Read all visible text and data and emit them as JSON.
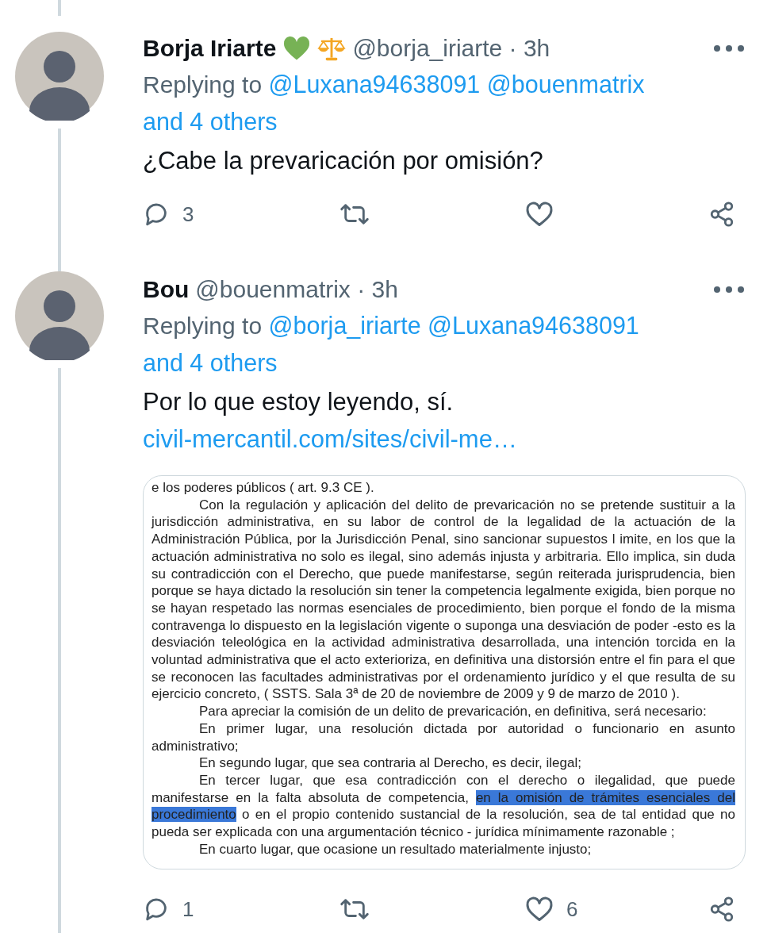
{
  "tweets": [
    {
      "author": "Borja Iriarte",
      "badges": [
        {
          "kind": "heart"
        },
        {
          "kind": "scales"
        }
      ],
      "meta": "@borja_iriarte · 3h",
      "replying_label": "Replying to",
      "mentions": [
        "@Luxana94638091",
        "@bouenmatrix"
      ],
      "others": "and 4 others",
      "text": "¿Cabe la prevaricación por omisión?",
      "stats": {
        "replies": "3"
      }
    },
    {
      "author": "Bou",
      "meta": "@bouenmatrix · 3h",
      "replying_label": "Replying to",
      "mentions": [
        "@borja_iriarte",
        "@Luxana94638091"
      ],
      "others": "and 4 others",
      "text": "Por lo que estoy leyendo, sí.",
      "link": "civil-mercantil.com/sites/civil-me…",
      "document": [
        {
          "indent": false,
          "text": "e los poderes públicos ( art. 9.3 CE )."
        },
        {
          "indent": true,
          "text": "Con la regulación y aplicación del delito de prevaricación no se pretende sustituir a la jurisdicción administrativa, en su labor de control de la legalidad de la actuación de la Administración Pública, por la Jurisdicción Penal, sino sancionar supuestos l imite, en los que la actuación administrativa no solo es ilegal, sino además injusta y arbitraria. Ello implica, sin duda su contradicción con el Derecho, que puede manifestarse, según reiterada jurisprudencia, bien porque se haya dictado la resolución sin tener la competencia legalmente exigida, bien porque no se hayan respetado las normas esenciales de procedimiento, bien porque el fondo de la misma contravenga lo dispuesto en la legislación vigente o suponga una desviación de poder -esto es la desviación teleológica en la actividad administrativa desarrollada, una intención torcida en la voluntad administrativa que el acto exterioriza, en definitiva una distorsión entre el fin para el que se reconocen las facultades administrativas por el ordenamiento jurídico y el que resulta de su ejercicio concreto, ( SSTS. Sala 3ª de 20 de noviembre de 2009 y 9 de marzo de 2010 )."
        },
        {
          "indent": true,
          "text": "Para apreciar la comisión de un delito de prevaricación, en definitiva, será necesario:"
        },
        {
          "indent": true,
          "text": "En primer lugar, una resolución dictada por autoridad o funcionario en asunto administrativo;"
        },
        {
          "indent": true,
          "text": "En segundo lugar, que sea contraria al Derecho, es decir, ilegal;"
        },
        {
          "indent": true,
          "text": "En tercer lugar, que esa contradicción con el derecho o ilegalidad, que puede manifestarse en la falta absoluta de competencia, ",
          "highlighted": "en la omisión de trámites esenciales del procedimiento",
          "text_after": " o en el propio contenido sustancial de la resolución, sea de tal entidad que no pueda ser explicada con una argumentación técnico - jurídica mínimamente razonable ;"
        },
        {
          "indent": true,
          "text": "En cuarto lugar, que ocasione un resultado materialmente injusto;"
        }
      ],
      "stats": {
        "replies": "1",
        "likes": "6"
      }
    }
  ]
}
